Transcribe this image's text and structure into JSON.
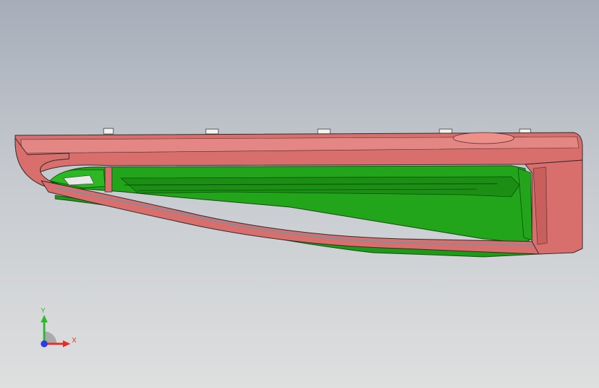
{
  "viewport": {
    "background_top": "#a6adb9",
    "background_bottom": "#dedfdf"
  },
  "model": {
    "shell_color": "#d96f6c",
    "shell_highlight": "#ef8f8a",
    "inner_color": "#22a51a",
    "inner_dark": "#0d6b0a",
    "edge_color": "#2a2a2a",
    "tab_color": "#f2f2ee"
  },
  "triad": {
    "x_label": "X",
    "y_label": "Y",
    "x_color": "#e0302a",
    "y_color": "#2fb82f",
    "z_color": "#2a3fe0",
    "icon": "coordinate-triad-icon"
  }
}
